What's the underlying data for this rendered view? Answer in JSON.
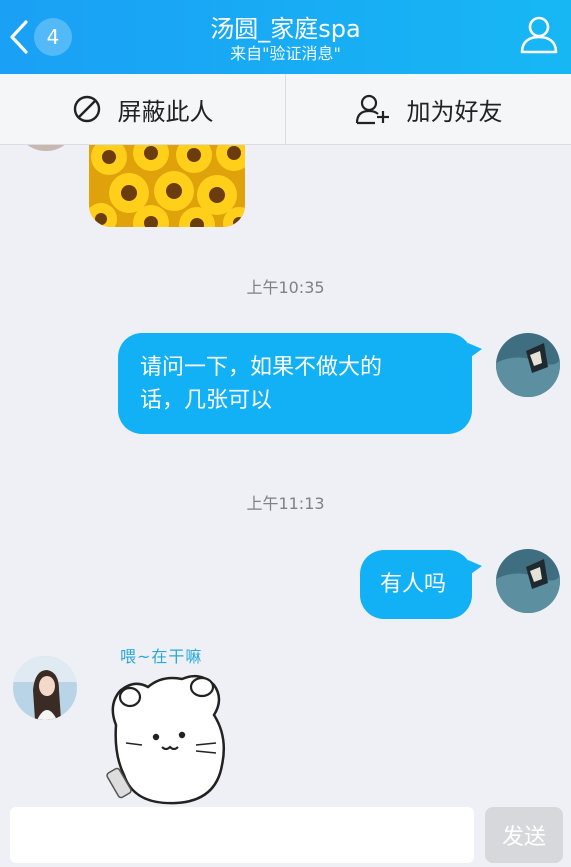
{
  "header": {
    "back_count": "4",
    "title": "汤圆_家庭spa",
    "subtitle": "来自\"验证消息\""
  },
  "actions": {
    "block_label": "屏蔽此人",
    "add_friend_label": "加为好友"
  },
  "messages": [
    {
      "type": "time",
      "text": "上午10:35"
    },
    {
      "type": "outgoing",
      "lines": [
        "请问一下，如果不做大的",
        "话，几张可以"
      ]
    },
    {
      "type": "time",
      "text": "上午11:13"
    },
    {
      "type": "outgoing",
      "lines": [
        "有人吗"
      ]
    },
    {
      "type": "incoming-sticker",
      "caption": "喂~在干嘛"
    }
  ],
  "input": {
    "value": "",
    "send_label": "发送"
  },
  "colors": {
    "header": "#1aa0f5",
    "bubble": "#12b1f5",
    "background": "#eef0f5"
  }
}
